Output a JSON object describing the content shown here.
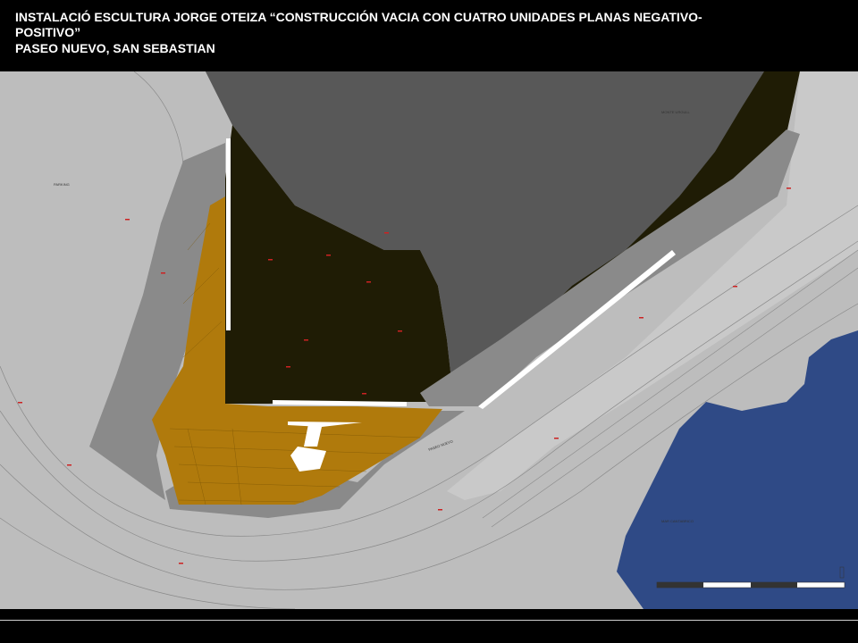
{
  "title": {
    "line1": "INSTALACIÓ ESCULTURA JORGE OTEIZA “CONSTRUCCIÓN VACIA CON CUATRO UNIDADES PLANAS NEGATIVO-",
    "line2": "POSITIVO”",
    "line3": "PASEO NUEVO, SAN SEBASTIAN"
  },
  "map": {
    "labels": {
      "parking": "PARKING",
      "monte_urgull": "MONTE URGULL",
      "paseo_nuevo": "PASEO NUEVO",
      "mar_cantabrico": "MAR CANTABRICO"
    },
    "colors": {
      "road": "#bdbdbd",
      "hill": "#585858",
      "vegetation": "#1f1c05",
      "plaza": "#b07a0c",
      "stepped_slope": "#8a8a8a",
      "sea": "#2f4a86",
      "sculpture": "#ffffff",
      "elevation_marks": "#cc2222"
    }
  }
}
